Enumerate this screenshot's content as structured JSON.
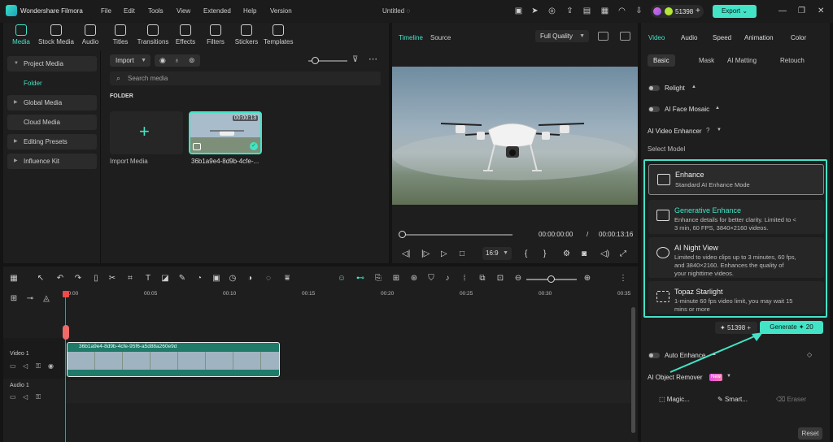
{
  "titlebar": {
    "app_name": "Wondershare Filmora",
    "menu": [
      "File",
      "Edit",
      "Tools",
      "View",
      "Extended",
      "Help",
      "Version"
    ],
    "project_title": "Untitled",
    "credits": "51398",
    "export_label": "Export"
  },
  "toolbar": {
    "items": [
      {
        "label": "Media",
        "icon": "media-icon"
      },
      {
        "label": "Stock Media",
        "icon": "stock-media-icon"
      },
      {
        "label": "Audio",
        "icon": "audio-icon"
      },
      {
        "label": "Titles",
        "icon": "titles-icon"
      },
      {
        "label": "Transitions",
        "icon": "transitions-icon"
      },
      {
        "label": "Effects",
        "icon": "effects-icon"
      },
      {
        "label": "Filters",
        "icon": "filters-icon"
      },
      {
        "label": "Stickers",
        "icon": "stickers-icon"
      },
      {
        "label": "Templates",
        "icon": "templates-icon"
      }
    ]
  },
  "media": {
    "sidebar": [
      "Project Media",
      "Folder",
      "Global Media",
      "Cloud Media",
      "Editing Presets",
      "Influence Kit"
    ],
    "import_label": "Import",
    "search_placeholder": "Search media",
    "folder_heading": "FOLDER",
    "import_tile_label": "Import Media",
    "clip_name": "36b1a9e4-8d9b-4cfe-...",
    "clip_duration": "00:00:13"
  },
  "player": {
    "tab_timeline": "Timeline",
    "tab_source": "Source",
    "quality": "Full Quality",
    "time_current": "00:00:00:00",
    "time_sep": "/",
    "time_total": "00:00:13:16",
    "ratio": "16:9"
  },
  "right_panel": {
    "tabs": [
      "Video",
      "Audio",
      "Speed",
      "Animation",
      "Color"
    ],
    "subtabs": [
      "Basic",
      "Mask",
      "AI Matting",
      "Retouch"
    ],
    "relight": "Relight",
    "face_mosaic": "AI Face Mosaic",
    "enhancer": "AI Video Enhancer",
    "select_model": "Select Model",
    "models": [
      {
        "title": "Enhance",
        "desc": "Standard AI Enhance Mode"
      },
      {
        "title": "Generative Enhance",
        "desc": "Enhance details for better clarity. Limited to < 3 min, 60 FPS, 3840×2160 videos."
      },
      {
        "title": "AI Night View",
        "desc": "Limited to video clips up to 3 minutes, 60 fps, and 3840×2160. Enhances the quality of your nighttime videos."
      },
      {
        "title": "Topaz Starlight",
        "desc": "1-minute 60 fps video limit, you may wait 15 mins or more"
      }
    ],
    "credits": "51398",
    "generate_label": "Generate",
    "generate_cost": "20",
    "auto_enhance": "Auto Enhance",
    "object_remover": "AI Object Remover",
    "new_badge": "New",
    "magic": "Magic...",
    "smart": "Smart...",
    "eraser": "Eraser",
    "reset": "Reset"
  },
  "timeline": {
    "ticks": [
      "00:00",
      "00:05",
      "00:10",
      "00:15",
      "00:20",
      "00:25",
      "00:30",
      "00:35"
    ],
    "video_track": "Video 1",
    "audio_track": "Audio 1",
    "clip_name": "36b1a9e4-8d9b-4cfe-95f6-a5d88a260e9d"
  },
  "colors": {
    "accent": "#43e3c6",
    "playhead": "#f04a4a",
    "clip": "#1f7a6a"
  }
}
